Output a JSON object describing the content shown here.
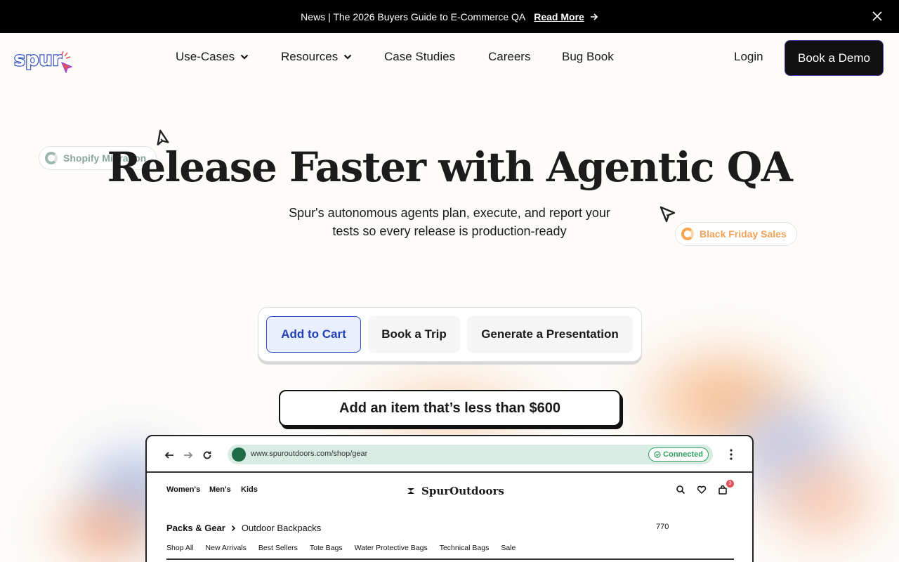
{
  "announcement": {
    "text": "News | The 2026 Buyers Guide to E-Commerce QA",
    "link_label": "Read More"
  },
  "nav": {
    "items": [
      {
        "label": "Use-Cases",
        "dropdown": true
      },
      {
        "label": "Resources",
        "dropdown": true
      },
      {
        "label": "Case Studies"
      },
      {
        "label": "Careers"
      },
      {
        "label": "Bug Book"
      }
    ],
    "login": "Login",
    "cta": "Book a Demo"
  },
  "hero": {
    "title": "Release Faster with Agentic QA",
    "subtitle_line1": "Spur's autonomous agents plan, execute, and report your",
    "subtitle_line2": "tests so every release is production-ready",
    "pill_left": "Shopify Migration",
    "pill_right": "Black Friday Sales"
  },
  "tabs": [
    {
      "label": "Add to Cart",
      "active": true
    },
    {
      "label": "Book a Trip"
    },
    {
      "label": "Generate a Presentation"
    }
  ],
  "prompt": "Add an item that’s less than $600",
  "browser": {
    "url": "www.spuroutdoors.com/shop/gear",
    "status": "Connected",
    "store": {
      "nav": [
        "Women's",
        "Men's",
        "Kids"
      ],
      "name": "SpurOutdoors",
      "cart_count": "3",
      "crumb_parent": "Packs & Gear",
      "crumb_current": "Outdoor Backpacks",
      "item_count": "770",
      "categories": [
        "Shop All",
        "New Arrivals",
        "Best Sellers",
        "Tote Bags",
        "Water Protective Bags",
        "Technical Bags",
        "Sale"
      ]
    }
  },
  "colors": {
    "accent_blue": "#2342b8",
    "connected_green": "#2f9e5e",
    "pill_orange": "#f1a15a",
    "pill_green": "#8aa69a"
  }
}
